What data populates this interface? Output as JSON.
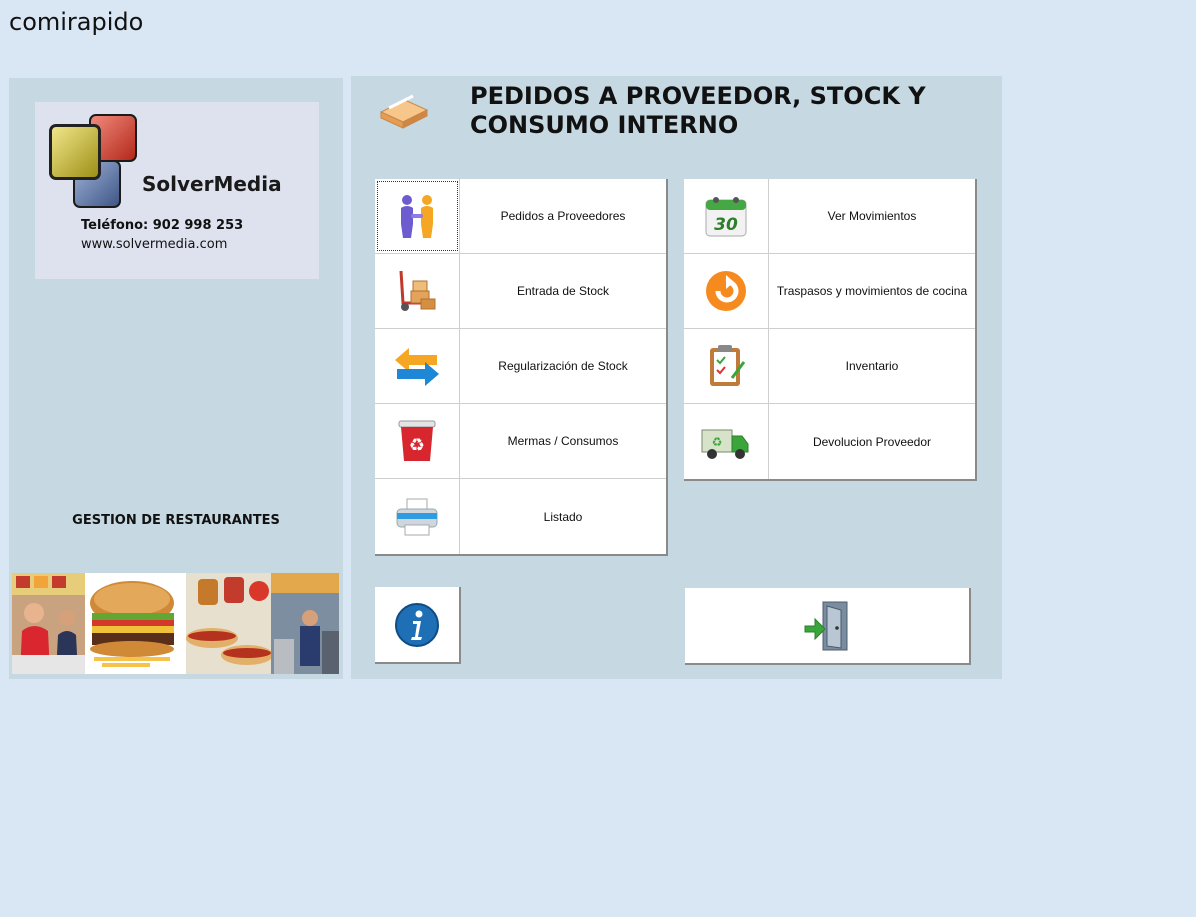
{
  "app": {
    "title": "comirapido"
  },
  "sidebar": {
    "brand": "SolverMedia",
    "phone": "Teléfono: 902 998 253",
    "website": "www.solvermedia.com",
    "tagline": "GESTION DE RESTAURANTES"
  },
  "main": {
    "title_line1": "PEDIDOS A PROVEEDOR, STOCK Y",
    "title_line2": "CONSUMO INTERNO",
    "left_buttons": [
      {
        "label": "Pedidos a Proveedores",
        "icon": "people-icon"
      },
      {
        "label": "Entrada de Stock",
        "icon": "hand-truck-icon"
      },
      {
        "label": "Regularización de Stock",
        "icon": "swap-arrows-icon"
      },
      {
        "label": "Mermas / Consumos",
        "icon": "recycle-bin-icon"
      },
      {
        "label": "Listado",
        "icon": "printer-icon"
      }
    ],
    "right_buttons": [
      {
        "label": "Ver Movimientos",
        "icon": "calendar-icon",
        "calendar_day": "30"
      },
      {
        "label": "Traspasos y movimientos de cocina",
        "icon": "refresh-icon"
      },
      {
        "label": "Inventario",
        "icon": "clipboard-icon"
      },
      {
        "label": "Devolucion Proveedor",
        "icon": "truck-icon"
      }
    ],
    "info_icon": "info-icon",
    "exit_icon": "exit-door-icon"
  },
  "colors": {
    "background": "#d9e6f4",
    "panel": "#c6d9e3",
    "logo_card": "#dde2ee"
  }
}
